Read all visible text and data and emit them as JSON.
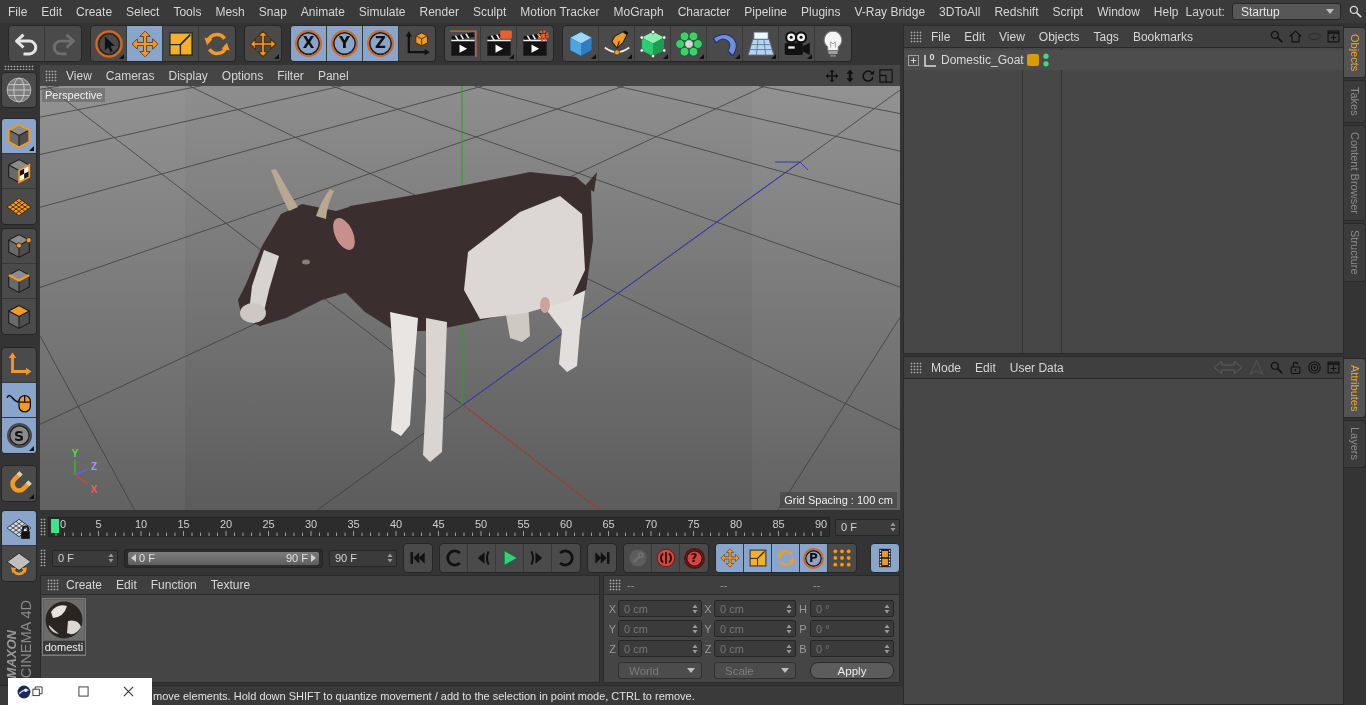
{
  "menu_bar": {
    "items": [
      "File",
      "Edit",
      "Create",
      "Select",
      "Tools",
      "Mesh",
      "Snap",
      "Animate",
      "Simulate",
      "Render",
      "Sculpt",
      "Motion Tracker",
      "MoGraph",
      "Character",
      "Pipeline",
      "Plugins",
      "V-Ray Bridge",
      "3DToAll",
      "Redshift",
      "Script",
      "Window",
      "Help"
    ],
    "layout_label": "Layout:",
    "layout_value": "Startup"
  },
  "main_toolbar": {
    "groups": [
      [
        {
          "selected": false,
          "disabled": false
        },
        {
          "selected": false,
          "disabled": true
        }
      ],
      [
        {
          "selected": false,
          "disabled": false
        },
        {
          "selected": true,
          "disabled": false
        },
        {
          "selected": false,
          "disabled": false
        },
        {
          "selected": false,
          "disabled": false
        }
      ],
      [
        {
          "selected": false,
          "disabled": false
        }
      ],
      [
        {
          "label": "X",
          "selected": true,
          "disabled": false
        },
        {
          "label": "Y",
          "selected": true,
          "disabled": false
        },
        {
          "label": "Z",
          "selected": true,
          "disabled": false
        },
        {
          "selected": false,
          "disabled": false
        }
      ],
      [
        {
          "selected": false,
          "disabled": false
        },
        {
          "selected": false,
          "disabled": false
        },
        {
          "selected": false,
          "disabled": false
        }
      ],
      [
        {
          "selected": false,
          "disabled": false
        },
        {
          "selected": false,
          "disabled": false
        },
        {
          "selected": false,
          "disabled": false
        },
        {
          "selected": false,
          "disabled": false
        },
        {
          "selected": false,
          "disabled": false
        },
        {
          "selected": false,
          "disabled": false
        },
        {
          "selected": false,
          "disabled": false
        },
        {
          "selected": false,
          "disabled": false
        }
      ]
    ]
  },
  "tool_palette": {
    "groups": [
      [
        {
          "selected": false
        }
      ],
      [
        {
          "selected": true
        },
        {
          "selected": false
        },
        {
          "selected": false
        }
      ],
      [
        {
          "selected": false
        },
        {
          "selected": false
        },
        {
          "selected": false
        }
      ],
      [
        {
          "selected": false
        },
        {
          "selected": true
        },
        {
          "label": "S",
          "selected": true
        }
      ],
      [
        {
          "selected": false
        }
      ]
    ]
  },
  "viewport": {
    "menu": [
      "View",
      "Cameras",
      "Display",
      "Options",
      "Filter",
      "Panel"
    ],
    "camera": "Perspective",
    "grid_spacing": "Grid Spacing : 100 cm",
    "axis_labels": [
      "Y",
      "Z",
      "X"
    ]
  },
  "timeline": {
    "frame_labels": [
      "0",
      "5",
      "10",
      "15",
      "20",
      "25",
      "30",
      "35",
      "40",
      "45",
      "50",
      "55",
      "60",
      "65",
      "70",
      "75",
      "80",
      "85",
      "90"
    ],
    "level": 0,
    "current_frame": "0 F"
  },
  "timeline_palette": [
    {
      "selected": true
    },
    {
      "selected": false
    }
  ],
  "playback": {
    "start_frame": "0 F",
    "range": {
      "start": "0 F",
      "end": "90 F",
      "level": 1
    },
    "end_frame": "90 F",
    "groups": [
      [
        {
          "selected": false,
          "disabled": false
        }
      ],
      [
        {
          "selected": false,
          "disabled": false
        },
        {
          "selected": false,
          "disabled": false
        },
        {
          "selected": false,
          "disabled": false
        },
        {
          "selected": false,
          "disabled": false
        },
        {
          "selected": false,
          "disabled": false
        }
      ],
      [
        {
          "selected": false,
          "disabled": false
        }
      ],
      [
        {
          "selected": false,
          "disabled": true
        },
        {
          "selected": false,
          "disabled": false
        },
        {
          "label": "?",
          "selected": false,
          "disabled": false
        }
      ],
      [
        {
          "selected": true,
          "disabled": false
        },
        {
          "selected": true,
          "disabled": false
        },
        {
          "selected": true,
          "disabled": false
        },
        {
          "label": "P",
          "selected": true,
          "disabled": false
        },
        {
          "selected": false,
          "disabled": false
        }
      ],
      [
        {
          "selected": true,
          "disabled": false
        }
      ]
    ]
  },
  "logo": {
    "brand": "MAXON",
    "product": "CINEMA 4D"
  },
  "material_manager": {
    "menu": [
      "Create",
      "Edit",
      "Function",
      "Texture"
    ],
    "materials": [
      {
        "name": "domesti",
        "selected": true
      }
    ]
  },
  "coordinates": {
    "headers": [
      "--",
      "--",
      "--"
    ],
    "rows": [
      [
        {
          "axis": "X",
          "value": "0 cm",
          "disabled": true
        },
        {
          "axis": "X",
          "value": "0 cm",
          "disabled": true
        },
        {
          "axis": "H",
          "value": "0 °",
          "disabled": true
        }
      ],
      [
        {
          "axis": "Y",
          "value": "0 cm",
          "disabled": true
        },
        {
          "axis": "Y",
          "value": "0 cm",
          "disabled": true
        },
        {
          "axis": "P",
          "value": "0 °",
          "disabled": true
        }
      ],
      [
        {
          "axis": "Z",
          "value": "0 cm",
          "disabled": true
        },
        {
          "axis": "Z",
          "value": "0 cm",
          "disabled": true
        },
        {
          "axis": "B",
          "value": "0 °",
          "disabled": true
        }
      ]
    ],
    "controls": [
      {
        "kind": "dropdown",
        "label": "World",
        "disabled": true
      },
      {
        "kind": "dropdown",
        "label": "Scale",
        "disabled": true
      },
      {
        "kind": "button",
        "label": "Apply",
        "disabled": false
      }
    ]
  },
  "object_manager": {
    "menu": [
      "File",
      "Edit",
      "View",
      "Objects",
      "Tags",
      "Bookmarks"
    ],
    "objects": [
      {
        "name": "Domestic_Goat",
        "icon_label": "0",
        "expanded": false
      }
    ]
  },
  "object_tabs": [
    {
      "label": "Objects",
      "selected": true
    },
    {
      "label": "Takes",
      "selected": false
    },
    {
      "label": "Content Browser",
      "selected": false
    },
    {
      "label": "Structure",
      "selected": false
    }
  ],
  "attribute_manager": {
    "menu": [
      "Mode",
      "Edit",
      "User Data"
    ]
  },
  "attribute_tabs": [
    {
      "label": "Attributes",
      "selected": true
    },
    {
      "label": "Layers",
      "selected": false
    }
  ],
  "status_bar": {
    "text": "move elements. Hold down SHIFT to quantize movement / add to the selection in point mode, CTRL to remove."
  }
}
